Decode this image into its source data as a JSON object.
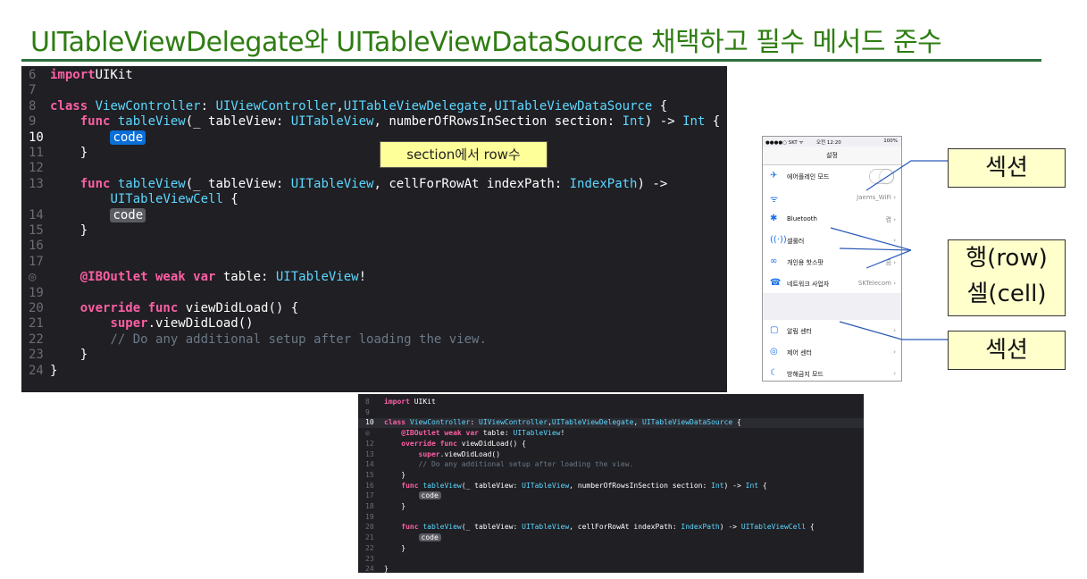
{
  "title": "UITableViewDelegate와 UITableViewDataSource 채택하고 필수 메서드 준수",
  "code_top": {
    "lines": [
      {
        "n": "6",
        "parts": [
          [
            "kw",
            "import"
          ],
          [
            "",
            "UIKit"
          ]
        ]
      },
      {
        "n": "7",
        "parts": []
      },
      {
        "n": "8",
        "parts": [
          [
            "kw",
            "class"
          ],
          [
            "",
            " "
          ],
          [
            "ty",
            "ViewController"
          ],
          [
            "",
            ": "
          ],
          [
            "ty",
            "UIViewController"
          ],
          [
            "",
            ","
          ],
          [
            "ty",
            "UITableViewDelegate"
          ],
          [
            "",
            ","
          ],
          [
            "ty",
            "UITableViewDataSource"
          ],
          [
            "",
            " {"
          ]
        ]
      },
      {
        "n": "9",
        "parts": [
          [
            "",
            "    "
          ],
          [
            "kw",
            "func"
          ],
          [
            "",
            " "
          ],
          [
            "ty",
            "tableView"
          ],
          [
            "",
            "(_ tableView: "
          ],
          [
            "ty",
            "UITableView"
          ],
          [
            "",
            ", numberOfRowsInSection section: "
          ],
          [
            "ty",
            "Int"
          ],
          [
            "",
            ") -> "
          ],
          [
            "ty",
            "Int"
          ],
          [
            "",
            " {"
          ]
        ]
      },
      {
        "n": "10",
        "cur": true,
        "parts": [
          [
            "",
            "        "
          ],
          [
            "phsel",
            "code"
          ]
        ]
      },
      {
        "n": "11",
        "parts": [
          [
            "",
            "    }"
          ]
        ]
      },
      {
        "n": "12",
        "parts": []
      },
      {
        "n": "13",
        "parts": [
          [
            "",
            "    "
          ],
          [
            "kw",
            "func"
          ],
          [
            "",
            " "
          ],
          [
            "ty",
            "tableView"
          ],
          [
            "",
            "(_ tableView: "
          ],
          [
            "ty",
            "UITableView"
          ],
          [
            "",
            ", cellForRowAt indexPath: "
          ],
          [
            "ty",
            "IndexPath"
          ],
          [
            "",
            ") ->"
          ]
        ]
      },
      {
        "n": "",
        "parts": [
          [
            "",
            "        "
          ],
          [
            "ty",
            "UITableViewCell"
          ],
          [
            "",
            " {"
          ]
        ]
      },
      {
        "n": "14",
        "parts": [
          [
            "",
            "        "
          ],
          [
            "ph",
            "code"
          ]
        ]
      },
      {
        "n": "15",
        "parts": [
          [
            "",
            "    }"
          ]
        ]
      },
      {
        "n": "16",
        "parts": []
      },
      {
        "n": "17",
        "parts": []
      },
      {
        "n": "◎",
        "parts": [
          [
            "",
            "    "
          ],
          [
            "kw",
            "@IBOutlet weak var"
          ],
          [
            "",
            " table: "
          ],
          [
            "ty",
            "UITableView"
          ],
          [
            "",
            "!"
          ]
        ]
      },
      {
        "n": "19",
        "parts": []
      },
      {
        "n": "20",
        "parts": [
          [
            "",
            "    "
          ],
          [
            "kw",
            "override func"
          ],
          [
            "",
            " viewDidLoad() {"
          ]
        ]
      },
      {
        "n": "21",
        "parts": [
          [
            "",
            "        "
          ],
          [
            "kw",
            "super"
          ],
          [
            "",
            ".viewDidLoad()"
          ]
        ]
      },
      {
        "n": "22",
        "parts": [
          [
            "",
            "        "
          ],
          [
            "cm",
            "// Do any additional setup after loading the view."
          ]
        ]
      },
      {
        "n": "23",
        "parts": [
          [
            "",
            "    }"
          ]
        ]
      },
      {
        "n": "24",
        "parts": [
          [
            "",
            "}"
          ]
        ]
      }
    ]
  },
  "code_bottom": {
    "lines": [
      {
        "n": "8",
        "parts": [
          [
            "kw",
            "import"
          ],
          [
            "",
            " UIKit"
          ]
        ]
      },
      {
        "n": "9",
        "parts": []
      },
      {
        "n": "10",
        "cur": true,
        "parts": [
          [
            "kw",
            "class"
          ],
          [
            "",
            " "
          ],
          [
            "ty",
            "ViewController"
          ],
          [
            "",
            ": "
          ],
          [
            "ty",
            "UIViewController"
          ],
          [
            "",
            ","
          ],
          [
            "ty",
            "UITableViewDelegate"
          ],
          [
            "",
            ", "
          ],
          [
            "ty",
            "UITableViewDataSource"
          ],
          [
            "",
            " {"
          ]
        ]
      },
      {
        "n": "◎",
        "parts": [
          [
            "",
            "    "
          ],
          [
            "kw",
            "@IBOutlet weak var"
          ],
          [
            "",
            " table: "
          ],
          [
            "ty",
            "UITableView"
          ],
          [
            "",
            "!"
          ]
        ]
      },
      {
        "n": "12",
        "parts": [
          [
            "",
            "    "
          ],
          [
            "kw",
            "override func"
          ],
          [
            "",
            " viewDidLoad() {"
          ]
        ]
      },
      {
        "n": "13",
        "parts": [
          [
            "",
            "        "
          ],
          [
            "kw",
            "super"
          ],
          [
            "",
            ".viewDidLoad()"
          ]
        ]
      },
      {
        "n": "14",
        "parts": [
          [
            "",
            "        "
          ],
          [
            "cm",
            "// Do any additional setup after loading the view."
          ]
        ]
      },
      {
        "n": "15",
        "parts": [
          [
            "",
            "    }"
          ]
        ]
      },
      {
        "n": "16",
        "parts": [
          [
            "",
            "    "
          ],
          [
            "kw",
            "func"
          ],
          [
            "",
            " "
          ],
          [
            "ty",
            "tableView"
          ],
          [
            "",
            "(_ tableView: "
          ],
          [
            "ty",
            "UITableView"
          ],
          [
            "",
            ", numberOfRowsInSection section: "
          ],
          [
            "ty",
            "Int"
          ],
          [
            "",
            ") -> "
          ],
          [
            "ty",
            "Int"
          ],
          [
            "",
            " {"
          ]
        ]
      },
      {
        "n": "17",
        "parts": [
          [
            "",
            "        "
          ],
          [
            "ph",
            "code"
          ]
        ]
      },
      {
        "n": "18",
        "parts": [
          [
            "",
            "    }"
          ]
        ]
      },
      {
        "n": "19",
        "parts": []
      },
      {
        "n": "20",
        "parts": [
          [
            "",
            "    "
          ],
          [
            "kw",
            "func"
          ],
          [
            "",
            " "
          ],
          [
            "ty",
            "tableView"
          ],
          [
            "",
            "(_ tableView: "
          ],
          [
            "ty",
            "UITableView"
          ],
          [
            "",
            ", cellForRowAt indexPath: "
          ],
          [
            "ty",
            "IndexPath"
          ],
          [
            "",
            ") -> "
          ],
          [
            "ty",
            "UITableViewCell"
          ],
          [
            "",
            " {"
          ]
        ]
      },
      {
        "n": "21",
        "parts": [
          [
            "",
            "        "
          ],
          [
            "ph",
            "code"
          ]
        ]
      },
      {
        "n": "22",
        "parts": [
          [
            "",
            "    }"
          ]
        ]
      },
      {
        "n": "23",
        "parts": []
      },
      {
        "n": "24",
        "parts": [
          [
            "",
            "}"
          ]
        ]
      }
    ]
  },
  "callout_section_rows": "section에서 row수",
  "labels": {
    "section_top": "섹션",
    "row_cell_1": "행(row)",
    "row_cell_2": "셀(cell)",
    "section_bottom": "섹션"
  },
  "phone": {
    "status_left": "●●●●○ SKT ᯤ",
    "status_time": "오전 12:20",
    "status_right": "100%",
    "nav_title": "설정",
    "rows": [
      {
        "icon": "✈",
        "label": "에어플레인 모드",
        "right": "",
        "toggle": true
      },
      {
        "icon": "ᯤ",
        "label": "",
        "right": "Jaems_WiFi  ›"
      },
      {
        "icon": "✱",
        "label": "Bluetooth",
        "right": "켬  ›"
      },
      {
        "icon": "((·))",
        "label": "셀룰러",
        "right": "›"
      },
      {
        "icon": "∞",
        "label": "개인용 핫스팟",
        "right": "끔  ›"
      },
      {
        "icon": "☎",
        "label": "네트워크 사업자",
        "right": "SKTelecom  ›"
      }
    ],
    "rows2": [
      {
        "icon": "▢",
        "label": "알림 센터",
        "right": "›"
      },
      {
        "icon": "◎",
        "label": "제어 센터",
        "right": "›"
      },
      {
        "icon": "☾",
        "label": "방해금지 모드",
        "right": "›"
      }
    ]
  }
}
